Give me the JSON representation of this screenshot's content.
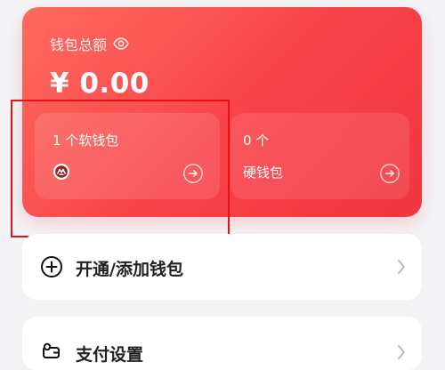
{
  "wallet": {
    "title": "钱包总额",
    "balance": "¥ 0.00",
    "soft": {
      "count": "1 个软钱包",
      "icon": "bank-logo-icon"
    },
    "hard": {
      "count": "0 个",
      "label": "硬钱包"
    }
  },
  "actions": {
    "open_wallet": "开通/添加钱包",
    "payment_settings": "支付设置"
  },
  "colors": {
    "card_gradient_start": "#ff6a5e",
    "card_gradient_end": "#f0353f",
    "highlight_box": "#e71217",
    "page_background": "#f3f3f6"
  }
}
